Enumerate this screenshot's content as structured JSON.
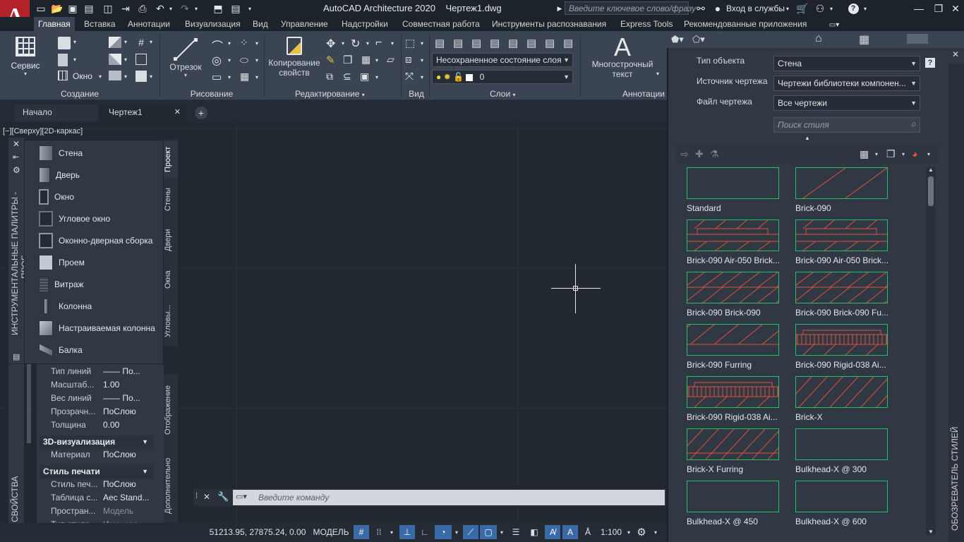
{
  "app": {
    "title": "AutoCAD Architecture 2020",
    "file": "Чертеж1.dwg",
    "logo_letter": "A",
    "search_placeholder": "Введите ключевое слово/фразу",
    "login": "Вход в службы",
    "help": "?"
  },
  "menu_tabs": [
    {
      "label": "Главная",
      "active": true
    },
    {
      "label": "Вставка"
    },
    {
      "label": "Аннотации"
    },
    {
      "label": "Визуализация"
    },
    {
      "label": "Вид"
    },
    {
      "label": "Управление"
    },
    {
      "label": "Надстройки"
    },
    {
      "label": "Совместная работа"
    },
    {
      "label": "Инструменты распознавания"
    },
    {
      "label": "Express Tools"
    },
    {
      "label": "Рекомендованные приложения"
    }
  ],
  "ribbon": {
    "service_label": "Сервис",
    "window_label": "Окно",
    "segment_label": "Отрезок",
    "copy_props_label_1": "Копирование",
    "copy_props_label_2": "свойств",
    "mtext_label_1": "Многострочный",
    "mtext_label_2": "текст",
    "mtext_glyph": "A",
    "layer_state": "Несохраненное состояние слоя",
    "layer_current": "0",
    "groups": {
      "create": "Создание",
      "draw": "Рисование",
      "edit": "Редактирование",
      "view": "Вид",
      "layers": "Слои",
      "annot": "Аннотации"
    }
  },
  "doc_tabs": {
    "start": "Начало",
    "drawing": "Чертеж1",
    "close": "✕",
    "add": "+"
  },
  "viewport_label": "[−][Сверху][2D-каркас]",
  "tool_palette": {
    "side_title": "ИНСТРУМЕНТАЛЬНЫЕ ПАЛИТРЫ - ПРОЕ...",
    "items": [
      "Стена",
      "Дверь",
      "Окно",
      "Угловое окно",
      "Оконно-дверная сборка",
      "Проем",
      "Витраж",
      "Колонна",
      "Настраиваемая колонна",
      "Балка"
    ],
    "tabs": [
      "Проект",
      "Стены",
      "Двери",
      "Окна",
      "Угловы..."
    ]
  },
  "properties": {
    "side_title": "СВОЙСТВА",
    "rows1": [
      {
        "k": "Тип линий",
        "v": "—— По..."
      },
      {
        "k": "Масштаб...",
        "v": "1.00"
      },
      {
        "k": "Вес линий",
        "v": "—— По..."
      },
      {
        "k": "Прозрачн...",
        "v": "ПоСлою"
      },
      {
        "k": "Толщина",
        "v": "0.00"
      }
    ],
    "section_3d": "3D-визуализация",
    "rows2": [
      {
        "k": "Материал",
        "v": "ПоСлою"
      }
    ],
    "section_print": "Стиль печати",
    "rows3": [
      {
        "k": "Стиль печ...",
        "v": "ПоСлою"
      },
      {
        "k": "Таблица с...",
        "v": "Aec Stand..."
      },
      {
        "k": "Простран...",
        "v": "Модель"
      },
      {
        "k": "Тип стиле...",
        "v": "Именова..."
      }
    ],
    "vtabs": [
      "Отображение",
      "Дополнительно"
    ]
  },
  "command_line": {
    "placeholder": "Введите команду"
  },
  "status": {
    "coords": "51213.95, 27875.24, 0.00",
    "model": "МОДЕЛЬ",
    "scale": "1:100"
  },
  "styles_browser": {
    "side_title": "ОБОЗРЕВАТЕЛЬ СТИЛЕЙ",
    "object_type_label": "Тип объекта",
    "object_type_value": "Стена",
    "source_label": "Источник чертежа",
    "source_value": "Чертежи библиотеки компонен...",
    "file_label": "Файл чертежа",
    "file_value": "Все чертежи",
    "search_placeholder": "Поиск стиля",
    "help": "?",
    "styles": [
      {
        "name": "Standard",
        "pattern": "blank"
      },
      {
        "name": "Brick-090",
        "pattern": "single"
      },
      {
        "name": "Brick-090 Air-050 Brick...",
        "pattern": "air"
      },
      {
        "name": "Brick-090 Air-050 Brick...",
        "pattern": "air"
      },
      {
        "name": "Brick-090 Brick-090",
        "pattern": "double"
      },
      {
        "name": "Brick-090 Brick-090 Fu...",
        "pattern": "double"
      },
      {
        "name": "Brick-090 Furring",
        "pattern": "furring"
      },
      {
        "name": "Brick-090 Rigid-038 Ai...",
        "pattern": "rigid"
      },
      {
        "name": "Brick-090 Rigid-038 Ai...",
        "pattern": "rigid"
      },
      {
        "name": "Brick-X",
        "pattern": "hatch"
      },
      {
        "name": "Brick-X Furring",
        "pattern": "hatchf"
      },
      {
        "name": "Bulkhead-X @ 300",
        "pattern": "blank"
      },
      {
        "name": "Bulkhead-X @ 450",
        "pattern": "blank"
      },
      {
        "name": "Bulkhead-X @ 600",
        "pattern": "blank"
      }
    ]
  },
  "colors": {
    "accent": "#3a6aa5",
    "swatch_border": "#25c06a",
    "hatch": "#e0523b"
  }
}
